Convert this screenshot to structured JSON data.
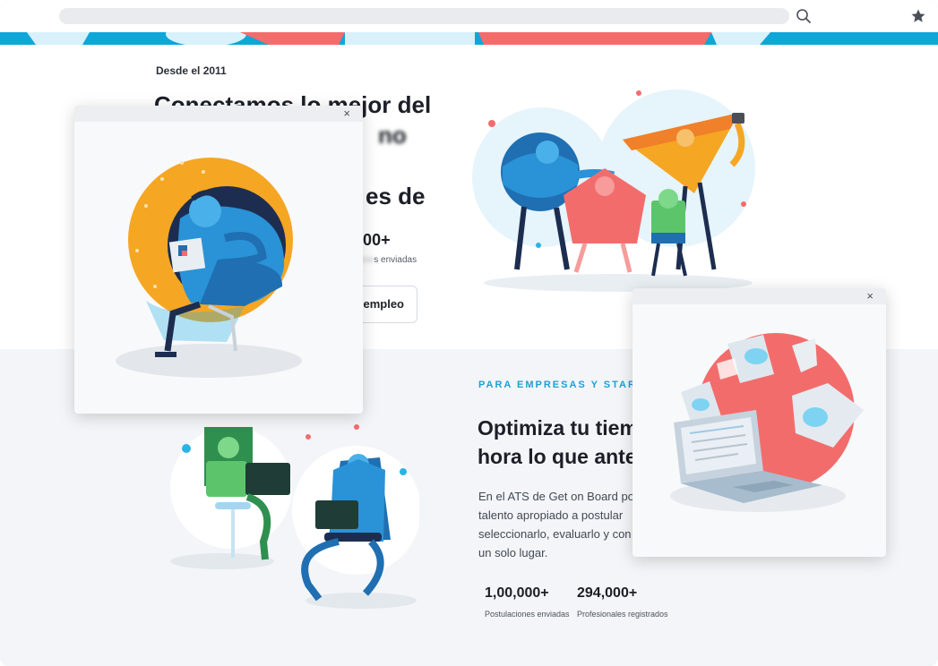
{
  "browser": {
    "search_icon": "search-icon",
    "bookmark_icon": "star-icon"
  },
  "hero": {
    "since": "Desde el 2011",
    "headline_visible": "Conectamos lo mejor del",
    "headline_line2_tail": "no con",
    "headline_line3_tail": "es de la",
    "stat_value": ",000+",
    "stat_label": "s enviadas",
    "cta_label": "empleo"
  },
  "companies": {
    "kicker": "PARA EMPRESAS Y STARTU",
    "heading": "Optimiza tu tiem hora lo que antes",
    "heading_line1": "Optimiza tu tiem",
    "heading_line2": "hora lo que antes",
    "paragraph_lines": [
      "En el ATS de Get on Board po",
      "talento apropiado a postular",
      "seleccionarlo, evaluarlo y con",
      "un solo lugar."
    ],
    "stats": [
      {
        "value": "1,00,000+",
        "label": "Postulaciones enviadas"
      },
      {
        "value": "294,000+",
        "label": "Profesionales registrados"
      }
    ]
  },
  "popups": [
    {
      "close_label": "×"
    },
    {
      "close_label": "×"
    }
  ],
  "colors": {
    "accent_blue": "#0fa6d8",
    "coral": "#f36c6c",
    "orange": "#f5a623",
    "green": "#5cc56b"
  }
}
